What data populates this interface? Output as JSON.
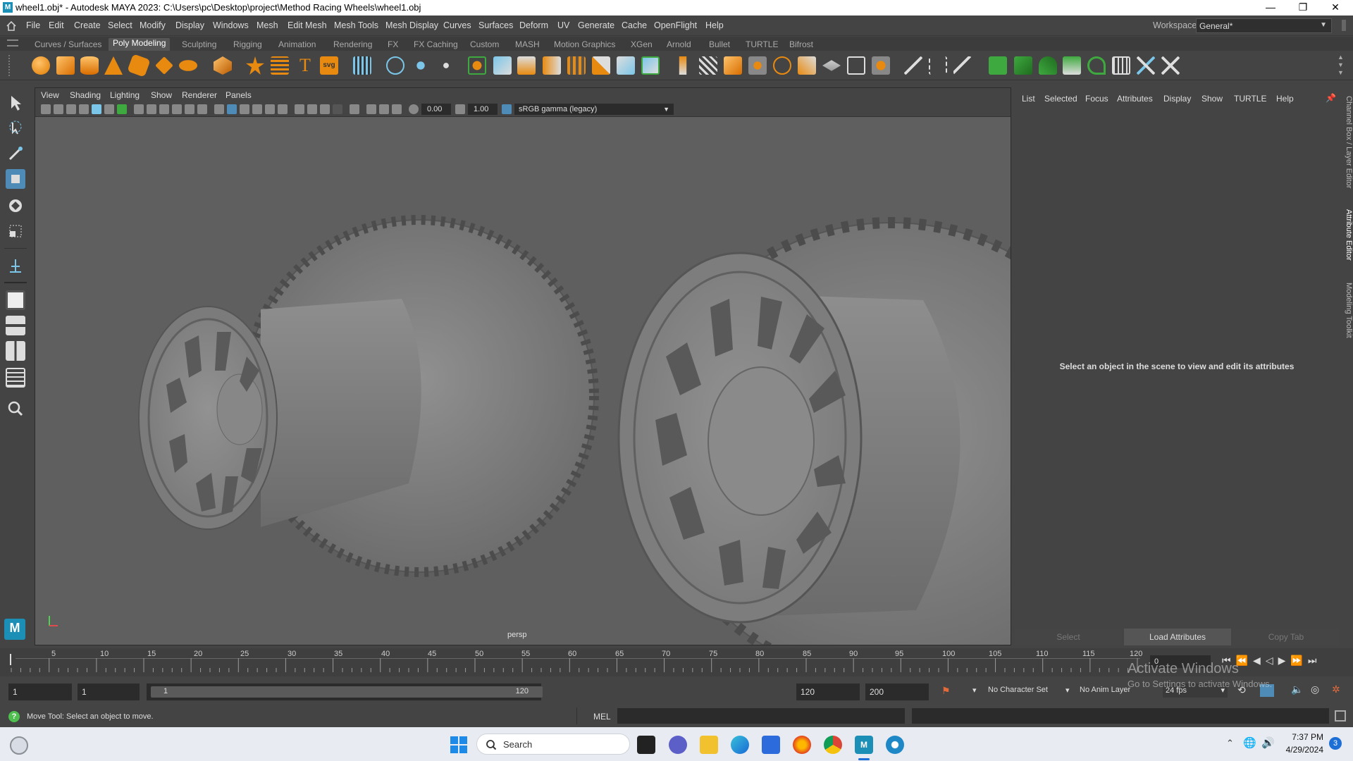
{
  "window": {
    "title": "wheel1.obj* - Autodesk MAYA 2023: C:\\Users\\pc\\Desktop\\project\\Method Racing Wheels\\wheel1.obj",
    "app_icon": "M",
    "minimize_glyph": "—",
    "restore_glyph": "❐",
    "close_glyph": "✕"
  },
  "menubar": {
    "items": [
      "File",
      "Edit",
      "Create",
      "Select",
      "Modify",
      "Display",
      "Windows",
      "Mesh",
      "Edit Mesh",
      "Mesh Tools",
      "Mesh Display",
      "Curves",
      "Surfaces",
      "Deform",
      "UV",
      "Generate",
      "Cache",
      "OpenFlight",
      "Help"
    ],
    "workspace_label": "Workspace:",
    "workspace_value": "General*"
  },
  "shelf_tabs": [
    "Curves / Surfaces",
    "Poly Modeling",
    "Sculpting",
    "Rigging",
    "Animation",
    "Rendering",
    "FX",
    "FX Caching",
    "Custom",
    "MASH",
    "Motion Graphics",
    "XGen",
    "Arnold",
    "Bullet",
    "TURTLE",
    "Bifrost"
  ],
  "shelf_active": "Poly Modeling",
  "viewport": {
    "menu": [
      "View",
      "Shading",
      "Lighting",
      "Show",
      "Renderer",
      "Panels"
    ],
    "exposure": "0.00",
    "gamma": "1.00",
    "color_space": "sRGB gamma (legacy)",
    "camera": "persp"
  },
  "attribute_editor": {
    "menu": [
      "List",
      "Selected",
      "Focus",
      "Attributes",
      "Display",
      "Show",
      "TURTLE",
      "Help"
    ],
    "message": "Select an object in the scene to view and edit its attributes",
    "buttons": {
      "select": "Select",
      "load": "Load Attributes",
      "copy": "Copy Tab"
    },
    "side_tabs": [
      "Channel Box / Layer Editor",
      "Attribute Editor",
      "Modeling Toolkit"
    ]
  },
  "timeline": {
    "ticks": [
      "5",
      "10",
      "15",
      "20",
      "25",
      "30",
      "35",
      "40",
      "45",
      "50",
      "55",
      "60",
      "65",
      "70",
      "75",
      "80",
      "85",
      "90",
      "95",
      "100",
      "105",
      "110",
      "115",
      "120"
    ],
    "current_frame": "0"
  },
  "range": {
    "start": "1",
    "playback_start": "1",
    "slider_start": "1",
    "slider_end": "120",
    "playback_end": "120",
    "end": "200",
    "character_set": "No Character Set",
    "anim_layer": "No Anim Layer",
    "fps": "24 fps"
  },
  "status": {
    "help_line": "Move Tool: Select an object to move.",
    "mel_label": "MEL"
  },
  "watermark": {
    "line1": "Activate Windows",
    "line2": "Go to Settings to activate Windows."
  },
  "taskbar": {
    "search": "Search",
    "time": "7:37 PM",
    "date": "4/29/2024",
    "notifications": "3"
  }
}
